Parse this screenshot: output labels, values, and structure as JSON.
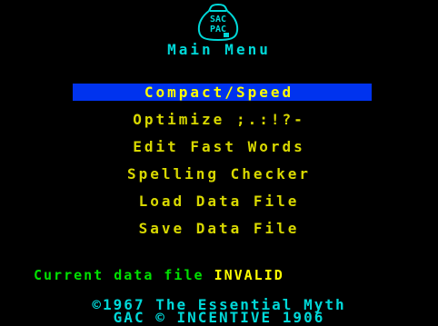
{
  "logo": {
    "line1": "SAC",
    "line2": "PAC",
    "icon": "sack-icon"
  },
  "header": {
    "title": "Main Menu"
  },
  "menu": {
    "items": [
      {
        "label": "Compact/Speed",
        "selected": true
      },
      {
        "label": "Optimize ;.:!?-",
        "selected": false
      },
      {
        "label": "Edit Fast Words",
        "selected": false
      },
      {
        "label": "Spelling Checker",
        "selected": false
      },
      {
        "label": "Load Data File",
        "selected": false
      },
      {
        "label": "Save Data File",
        "selected": false
      }
    ]
  },
  "status": {
    "label": "Current data file",
    "value": "INVALID"
  },
  "footer": {
    "line1": "©1967 The Essential Myth",
    "line2": "GAC © INCENTIVE 1906"
  },
  "colors": {
    "background": "#000000",
    "title": "#00d8d8",
    "menu_text": "#d8d800",
    "highlight_bar": "#0033ee",
    "status_label": "#00e000",
    "status_value": "#ffff00"
  }
}
